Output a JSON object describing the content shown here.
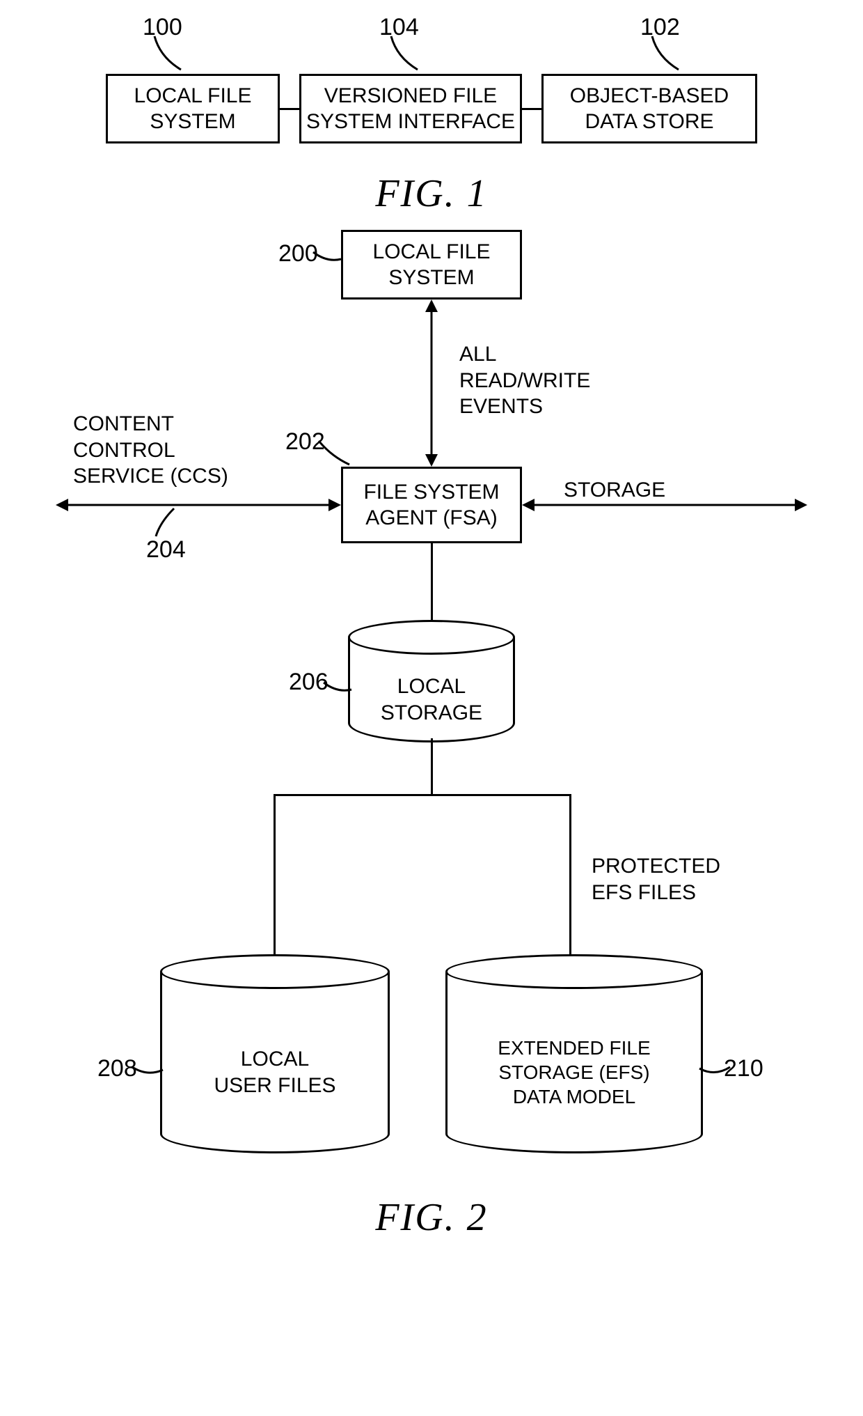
{
  "fig1": {
    "refs": {
      "r100": "100",
      "r104": "104",
      "r102": "102"
    },
    "boxes": {
      "local_file_system": "LOCAL FILE\nSYSTEM",
      "vfs_interface": "VERSIONED FILE\nSYSTEM INTERFACE",
      "object_store": "OBJECT-BASED\nDATA STORE"
    },
    "caption": "FIG. 1"
  },
  "fig2": {
    "refs": {
      "r200": "200",
      "r202": "202",
      "r204": "204",
      "r206": "206",
      "r208": "208",
      "r210": "210"
    },
    "boxes": {
      "local_file_system": "LOCAL FILE\nSYSTEM",
      "file_system_agent": "FILE SYSTEM\nAGENT (FSA)",
      "local_storage": "LOCAL\nSTORAGE",
      "local_user_files": "LOCAL\nUSER FILES",
      "efs": "EXTENDED FILE\nSTORAGE (EFS)\nDATA MODEL"
    },
    "labels": {
      "rw_events": "ALL\nREAD/WRITE\nEVENTS",
      "ccs": "CONTENT\nCONTROL\nSERVICE (CCS)",
      "storage": "STORAGE",
      "protected": "PROTECTED\nEFS FILES"
    },
    "caption": "FIG. 2"
  }
}
